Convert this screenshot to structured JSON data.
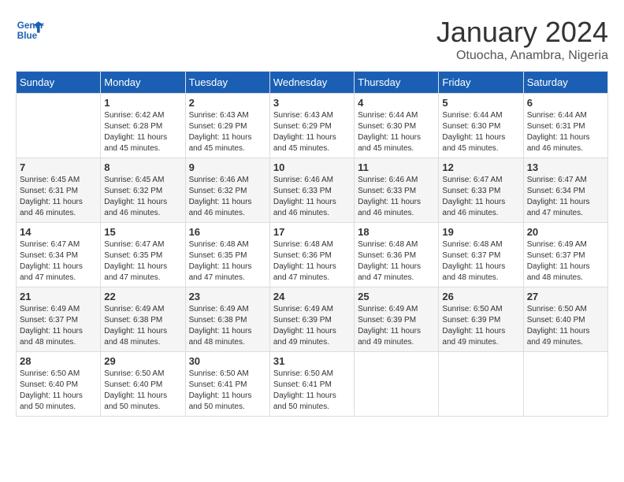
{
  "logo": {
    "line1": "General",
    "line2": "Blue"
  },
  "title": "January 2024",
  "subtitle": "Otuocha, Anambra, Nigeria",
  "days_of_week": [
    "Sunday",
    "Monday",
    "Tuesday",
    "Wednesday",
    "Thursday",
    "Friday",
    "Saturday"
  ],
  "weeks": [
    [
      {
        "day": "",
        "info": ""
      },
      {
        "day": "1",
        "info": "Sunrise: 6:42 AM\nSunset: 6:28 PM\nDaylight: 11 hours\nand 45 minutes."
      },
      {
        "day": "2",
        "info": "Sunrise: 6:43 AM\nSunset: 6:29 PM\nDaylight: 11 hours\nand 45 minutes."
      },
      {
        "day": "3",
        "info": "Sunrise: 6:43 AM\nSunset: 6:29 PM\nDaylight: 11 hours\nand 45 minutes."
      },
      {
        "day": "4",
        "info": "Sunrise: 6:44 AM\nSunset: 6:30 PM\nDaylight: 11 hours\nand 45 minutes."
      },
      {
        "day": "5",
        "info": "Sunrise: 6:44 AM\nSunset: 6:30 PM\nDaylight: 11 hours\nand 45 minutes."
      },
      {
        "day": "6",
        "info": "Sunrise: 6:44 AM\nSunset: 6:31 PM\nDaylight: 11 hours\nand 46 minutes."
      }
    ],
    [
      {
        "day": "7",
        "info": "Sunrise: 6:45 AM\nSunset: 6:31 PM\nDaylight: 11 hours\nand 46 minutes."
      },
      {
        "day": "8",
        "info": "Sunrise: 6:45 AM\nSunset: 6:32 PM\nDaylight: 11 hours\nand 46 minutes."
      },
      {
        "day": "9",
        "info": "Sunrise: 6:46 AM\nSunset: 6:32 PM\nDaylight: 11 hours\nand 46 minutes."
      },
      {
        "day": "10",
        "info": "Sunrise: 6:46 AM\nSunset: 6:33 PM\nDaylight: 11 hours\nand 46 minutes."
      },
      {
        "day": "11",
        "info": "Sunrise: 6:46 AM\nSunset: 6:33 PM\nDaylight: 11 hours\nand 46 minutes."
      },
      {
        "day": "12",
        "info": "Sunrise: 6:47 AM\nSunset: 6:33 PM\nDaylight: 11 hours\nand 46 minutes."
      },
      {
        "day": "13",
        "info": "Sunrise: 6:47 AM\nSunset: 6:34 PM\nDaylight: 11 hours\nand 47 minutes."
      }
    ],
    [
      {
        "day": "14",
        "info": "Sunrise: 6:47 AM\nSunset: 6:34 PM\nDaylight: 11 hours\nand 47 minutes."
      },
      {
        "day": "15",
        "info": "Sunrise: 6:47 AM\nSunset: 6:35 PM\nDaylight: 11 hours\nand 47 minutes."
      },
      {
        "day": "16",
        "info": "Sunrise: 6:48 AM\nSunset: 6:35 PM\nDaylight: 11 hours\nand 47 minutes."
      },
      {
        "day": "17",
        "info": "Sunrise: 6:48 AM\nSunset: 6:36 PM\nDaylight: 11 hours\nand 47 minutes."
      },
      {
        "day": "18",
        "info": "Sunrise: 6:48 AM\nSunset: 6:36 PM\nDaylight: 11 hours\nand 47 minutes."
      },
      {
        "day": "19",
        "info": "Sunrise: 6:48 AM\nSunset: 6:37 PM\nDaylight: 11 hours\nand 48 minutes."
      },
      {
        "day": "20",
        "info": "Sunrise: 6:49 AM\nSunset: 6:37 PM\nDaylight: 11 hours\nand 48 minutes."
      }
    ],
    [
      {
        "day": "21",
        "info": "Sunrise: 6:49 AM\nSunset: 6:37 PM\nDaylight: 11 hours\nand 48 minutes."
      },
      {
        "day": "22",
        "info": "Sunrise: 6:49 AM\nSunset: 6:38 PM\nDaylight: 11 hours\nand 48 minutes."
      },
      {
        "day": "23",
        "info": "Sunrise: 6:49 AM\nSunset: 6:38 PM\nDaylight: 11 hours\nand 48 minutes."
      },
      {
        "day": "24",
        "info": "Sunrise: 6:49 AM\nSunset: 6:39 PM\nDaylight: 11 hours\nand 49 minutes."
      },
      {
        "day": "25",
        "info": "Sunrise: 6:49 AM\nSunset: 6:39 PM\nDaylight: 11 hours\nand 49 minutes."
      },
      {
        "day": "26",
        "info": "Sunrise: 6:50 AM\nSunset: 6:39 PM\nDaylight: 11 hours\nand 49 minutes."
      },
      {
        "day": "27",
        "info": "Sunrise: 6:50 AM\nSunset: 6:40 PM\nDaylight: 11 hours\nand 49 minutes."
      }
    ],
    [
      {
        "day": "28",
        "info": "Sunrise: 6:50 AM\nSunset: 6:40 PM\nDaylight: 11 hours\nand 50 minutes."
      },
      {
        "day": "29",
        "info": "Sunrise: 6:50 AM\nSunset: 6:40 PM\nDaylight: 11 hours\nand 50 minutes."
      },
      {
        "day": "30",
        "info": "Sunrise: 6:50 AM\nSunset: 6:41 PM\nDaylight: 11 hours\nand 50 minutes."
      },
      {
        "day": "31",
        "info": "Sunrise: 6:50 AM\nSunset: 6:41 PM\nDaylight: 11 hours\nand 50 minutes."
      },
      {
        "day": "",
        "info": ""
      },
      {
        "day": "",
        "info": ""
      },
      {
        "day": "",
        "info": ""
      }
    ]
  ]
}
